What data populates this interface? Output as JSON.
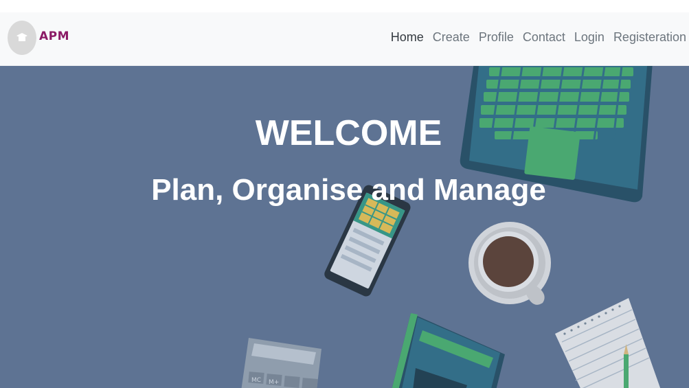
{
  "brand": {
    "logo_text": "APM"
  },
  "nav": {
    "items": [
      {
        "label": "Home",
        "active": true
      },
      {
        "label": "Create"
      },
      {
        "label": "Profile"
      },
      {
        "label": "Contact"
      },
      {
        "label": "Login"
      },
      {
        "label": "Registeration"
      }
    ]
  },
  "hero": {
    "title": "WELCOME",
    "subtitle": "Plan, Organise and Manage",
    "background_color": "#5f7393"
  },
  "calculator": {
    "keys": [
      "MC",
      "M+"
    ]
  },
  "colors": {
    "brand": "#8b1a66",
    "navbar_bg": "#f8f9fa",
    "nav_text": "#6c757d",
    "nav_active": "#343a40"
  }
}
